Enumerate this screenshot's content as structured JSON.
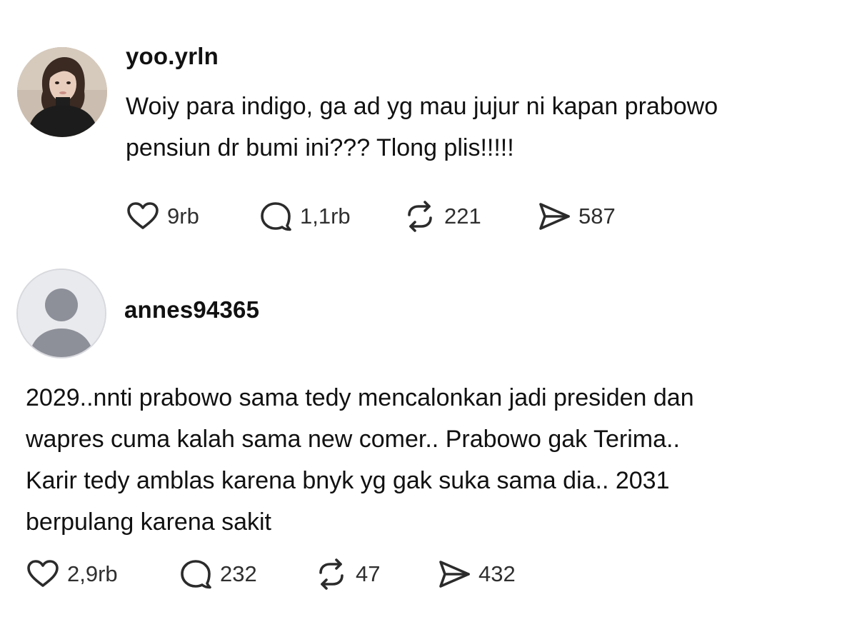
{
  "posts": [
    {
      "username": "yoo.yrln",
      "text_lines": [
        "Woiy para indigo, ga ad yg mau jujur ni kapan prabowo",
        "pensiun dr bumi ini??? Tlong plis!!!!!"
      ],
      "avatar": "profile-photo",
      "actions": {
        "likes": "9rb",
        "replies": "1,1rb",
        "reposts": "221",
        "shares": "587"
      }
    },
    {
      "username": "annes94365",
      "text_lines": [
        "2029..nnti prabowo sama tedy mencalonkan jadi presiden dan",
        "wapres cuma kalah sama new comer.. Prabowo gak Terima..",
        "Karir tedy amblas karena bnyk yg gak suka sama dia.. 2031",
        "berpulang karena sakit"
      ],
      "avatar": "default-user-silhouette",
      "actions": {
        "likes": "2,9rb",
        "replies": "232",
        "reposts": "47",
        "shares": "432"
      }
    }
  ],
  "icons": {
    "like": "heart-icon",
    "reply": "speech-bubble-icon",
    "repost": "repost-arrows-icon",
    "share": "paper-plane-icon"
  },
  "colors": {
    "text": "#111111",
    "count": "#2f2f2f",
    "icon": "#2b2b2b",
    "default_avatar_bg": "#e9eaee",
    "default_avatar_fg": "#8e9099"
  }
}
